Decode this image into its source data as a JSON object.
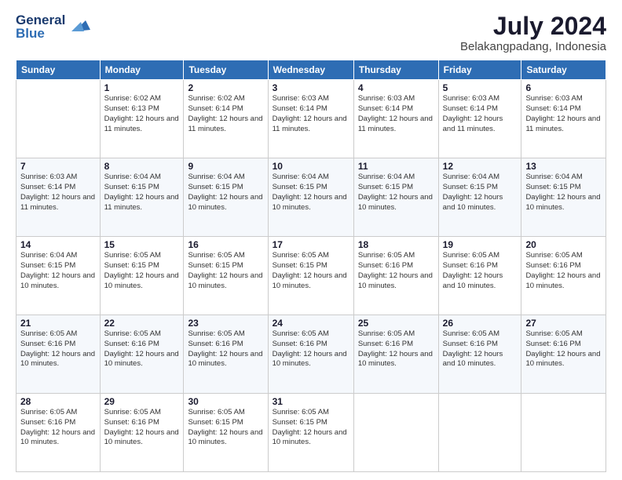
{
  "logo": {
    "line1": "General",
    "line2": "Blue"
  },
  "title": "July 2024",
  "location": "Belakangpadang, Indonesia",
  "days_header": [
    "Sunday",
    "Monday",
    "Tuesday",
    "Wednesday",
    "Thursday",
    "Friday",
    "Saturday"
  ],
  "weeks": [
    [
      {
        "day": "",
        "sunrise": "",
        "sunset": "",
        "daylight": ""
      },
      {
        "day": "1",
        "sunrise": "Sunrise: 6:02 AM",
        "sunset": "Sunset: 6:13 PM",
        "daylight": "Daylight: 12 hours and 11 minutes."
      },
      {
        "day": "2",
        "sunrise": "Sunrise: 6:02 AM",
        "sunset": "Sunset: 6:14 PM",
        "daylight": "Daylight: 12 hours and 11 minutes."
      },
      {
        "day": "3",
        "sunrise": "Sunrise: 6:03 AM",
        "sunset": "Sunset: 6:14 PM",
        "daylight": "Daylight: 12 hours and 11 minutes."
      },
      {
        "day": "4",
        "sunrise": "Sunrise: 6:03 AM",
        "sunset": "Sunset: 6:14 PM",
        "daylight": "Daylight: 12 hours and 11 minutes."
      },
      {
        "day": "5",
        "sunrise": "Sunrise: 6:03 AM",
        "sunset": "Sunset: 6:14 PM",
        "daylight": "Daylight: 12 hours and 11 minutes."
      },
      {
        "day": "6",
        "sunrise": "Sunrise: 6:03 AM",
        "sunset": "Sunset: 6:14 PM",
        "daylight": "Daylight: 12 hours and 11 minutes."
      }
    ],
    [
      {
        "day": "7",
        "sunrise": "Sunrise: 6:03 AM",
        "sunset": "Sunset: 6:14 PM",
        "daylight": "Daylight: 12 hours and 11 minutes."
      },
      {
        "day": "8",
        "sunrise": "Sunrise: 6:04 AM",
        "sunset": "Sunset: 6:15 PM",
        "daylight": "Daylight: 12 hours and 11 minutes."
      },
      {
        "day": "9",
        "sunrise": "Sunrise: 6:04 AM",
        "sunset": "Sunset: 6:15 PM",
        "daylight": "Daylight: 12 hours and 10 minutes."
      },
      {
        "day": "10",
        "sunrise": "Sunrise: 6:04 AM",
        "sunset": "Sunset: 6:15 PM",
        "daylight": "Daylight: 12 hours and 10 minutes."
      },
      {
        "day": "11",
        "sunrise": "Sunrise: 6:04 AM",
        "sunset": "Sunset: 6:15 PM",
        "daylight": "Daylight: 12 hours and 10 minutes."
      },
      {
        "day": "12",
        "sunrise": "Sunrise: 6:04 AM",
        "sunset": "Sunset: 6:15 PM",
        "daylight": "Daylight: 12 hours and 10 minutes."
      },
      {
        "day": "13",
        "sunrise": "Sunrise: 6:04 AM",
        "sunset": "Sunset: 6:15 PM",
        "daylight": "Daylight: 12 hours and 10 minutes."
      }
    ],
    [
      {
        "day": "14",
        "sunrise": "Sunrise: 6:04 AM",
        "sunset": "Sunset: 6:15 PM",
        "daylight": "Daylight: 12 hours and 10 minutes."
      },
      {
        "day": "15",
        "sunrise": "Sunrise: 6:05 AM",
        "sunset": "Sunset: 6:15 PM",
        "daylight": "Daylight: 12 hours and 10 minutes."
      },
      {
        "day": "16",
        "sunrise": "Sunrise: 6:05 AM",
        "sunset": "Sunset: 6:15 PM",
        "daylight": "Daylight: 12 hours and 10 minutes."
      },
      {
        "day": "17",
        "sunrise": "Sunrise: 6:05 AM",
        "sunset": "Sunset: 6:15 PM",
        "daylight": "Daylight: 12 hours and 10 minutes."
      },
      {
        "day": "18",
        "sunrise": "Sunrise: 6:05 AM",
        "sunset": "Sunset: 6:16 PM",
        "daylight": "Daylight: 12 hours and 10 minutes."
      },
      {
        "day": "19",
        "sunrise": "Sunrise: 6:05 AM",
        "sunset": "Sunset: 6:16 PM",
        "daylight": "Daylight: 12 hours and 10 minutes."
      },
      {
        "day": "20",
        "sunrise": "Sunrise: 6:05 AM",
        "sunset": "Sunset: 6:16 PM",
        "daylight": "Daylight: 12 hours and 10 minutes."
      }
    ],
    [
      {
        "day": "21",
        "sunrise": "Sunrise: 6:05 AM",
        "sunset": "Sunset: 6:16 PM",
        "daylight": "Daylight: 12 hours and 10 minutes."
      },
      {
        "day": "22",
        "sunrise": "Sunrise: 6:05 AM",
        "sunset": "Sunset: 6:16 PM",
        "daylight": "Daylight: 12 hours and 10 minutes."
      },
      {
        "day": "23",
        "sunrise": "Sunrise: 6:05 AM",
        "sunset": "Sunset: 6:16 PM",
        "daylight": "Daylight: 12 hours and 10 minutes."
      },
      {
        "day": "24",
        "sunrise": "Sunrise: 6:05 AM",
        "sunset": "Sunset: 6:16 PM",
        "daylight": "Daylight: 12 hours and 10 minutes."
      },
      {
        "day": "25",
        "sunrise": "Sunrise: 6:05 AM",
        "sunset": "Sunset: 6:16 PM",
        "daylight": "Daylight: 12 hours and 10 minutes."
      },
      {
        "day": "26",
        "sunrise": "Sunrise: 6:05 AM",
        "sunset": "Sunset: 6:16 PM",
        "daylight": "Daylight: 12 hours and 10 minutes."
      },
      {
        "day": "27",
        "sunrise": "Sunrise: 6:05 AM",
        "sunset": "Sunset: 6:16 PM",
        "daylight": "Daylight: 12 hours and 10 minutes."
      }
    ],
    [
      {
        "day": "28",
        "sunrise": "Sunrise: 6:05 AM",
        "sunset": "Sunset: 6:16 PM",
        "daylight": "Daylight: 12 hours and 10 minutes."
      },
      {
        "day": "29",
        "sunrise": "Sunrise: 6:05 AM",
        "sunset": "Sunset: 6:16 PM",
        "daylight": "Daylight: 12 hours and 10 minutes."
      },
      {
        "day": "30",
        "sunrise": "Sunrise: 6:05 AM",
        "sunset": "Sunset: 6:15 PM",
        "daylight": "Daylight: 12 hours and 10 minutes."
      },
      {
        "day": "31",
        "sunrise": "Sunrise: 6:05 AM",
        "sunset": "Sunset: 6:15 PM",
        "daylight": "Daylight: 12 hours and 10 minutes."
      },
      {
        "day": "",
        "sunrise": "",
        "sunset": "",
        "daylight": ""
      },
      {
        "day": "",
        "sunrise": "",
        "sunset": "",
        "daylight": ""
      },
      {
        "day": "",
        "sunrise": "",
        "sunset": "",
        "daylight": ""
      }
    ]
  ]
}
